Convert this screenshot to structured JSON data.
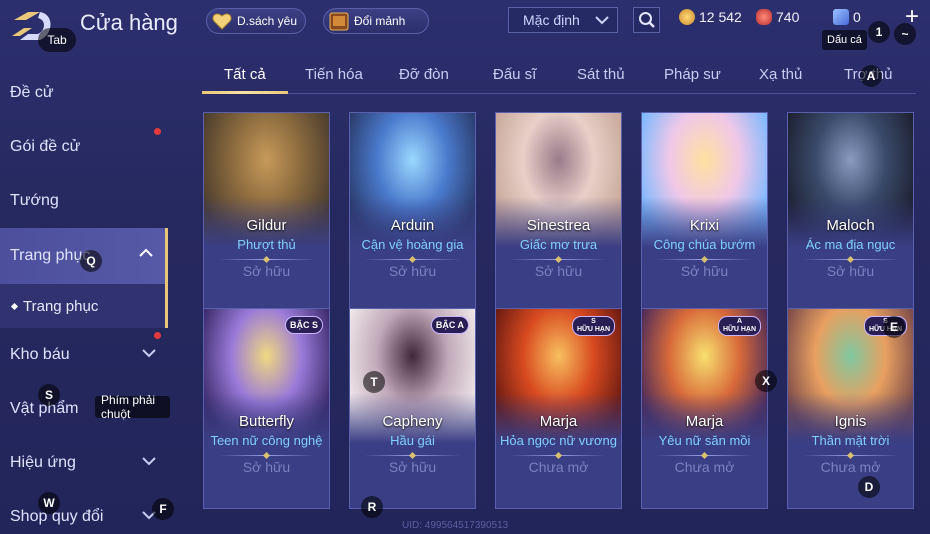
{
  "header": {
    "title": "Cửa hàng",
    "back_key": "Tab",
    "wishlist_label": "D.sách yêu",
    "exchange_label": "Đổi mảnh",
    "sort_value": "Mặc định",
    "currencies": [
      {
        "name": "gold",
        "value": "12 542",
        "color": "#e8b34a"
      },
      {
        "name": "quan-huy",
        "value": "740",
        "color": "#d8504a"
      },
      {
        "name": "vouchers",
        "value": "0",
        "color": "#6aa0ff"
      }
    ],
    "tooltip": "Dấu cá",
    "key_1": "1",
    "key_tilde": "~",
    "plus": "+"
  },
  "sidebar": {
    "items": [
      {
        "label": "Đề cử"
      },
      {
        "label": "Gói đề cử",
        "badge": true
      },
      {
        "label": "Tướng"
      },
      {
        "label": "Trang phục",
        "expanded": true
      },
      {
        "label": "Kho báu",
        "badge": true
      },
      {
        "label": "Vật phẩm"
      },
      {
        "label": "Hiệu ứng"
      },
      {
        "label": "Shop quy đổi"
      }
    ],
    "sub_item": "Trang phục",
    "tooltip": "Phím phải chuột",
    "keys": {
      "q": "Q",
      "s": "S",
      "w": "W",
      "f": "F"
    }
  },
  "tabs": [
    "Tất cả",
    "Tiến hóa",
    "Đỡ đòn",
    "Đấu sĩ",
    "Sát thủ",
    "Pháp sư",
    "Xạ thủ",
    "Trợ thủ"
  ],
  "tab_key": "A",
  "cards": [
    {
      "hero": "Gildur",
      "skin": "Phượt thủ",
      "status": "Sở hữu",
      "grade": ""
    },
    {
      "hero": "Arduin",
      "skin": "Cận vệ hoàng gia",
      "status": "Sở hữu",
      "grade": ""
    },
    {
      "hero": "Sinestrea",
      "skin": "Giấc mơ trưa",
      "status": "Sở hữu",
      "grade": ""
    },
    {
      "hero": "Krixi",
      "skin": "Công chúa bướm",
      "status": "Sở hữu",
      "grade": ""
    },
    {
      "hero": "Maloch",
      "skin": "Ác ma địa ngục",
      "status": "Sở hữu",
      "grade": ""
    },
    {
      "hero": "Butterfly",
      "skin": "Teen nữ công nghệ",
      "status": "Sở hữu",
      "grade": "BẬC S"
    },
    {
      "hero": "Capheny",
      "skin": "Hầu gái",
      "status": "Sở hữu",
      "grade": "BẬC A"
    },
    {
      "hero": "Marja",
      "skin": "Hỏa ngọc nữ vương",
      "status": "Chưa mở",
      "grade": "S",
      "grade_sub": "HỮU HẠN"
    },
    {
      "hero": "Marja",
      "skin": "Yêu nữ săn mồi",
      "status": "Chưa mở",
      "grade": "A",
      "grade_sub": "HỮU HẠN"
    },
    {
      "hero": "Ignis",
      "skin": "Thần mặt trời",
      "status": "Chưa mở",
      "grade": "S",
      "grade_sub": "HỮU HẠN"
    }
  ],
  "card_keys": {
    "t": "T",
    "x": "X",
    "r": "R",
    "d": "D",
    "e": "E"
  },
  "uid": "UID: 499564517390513"
}
